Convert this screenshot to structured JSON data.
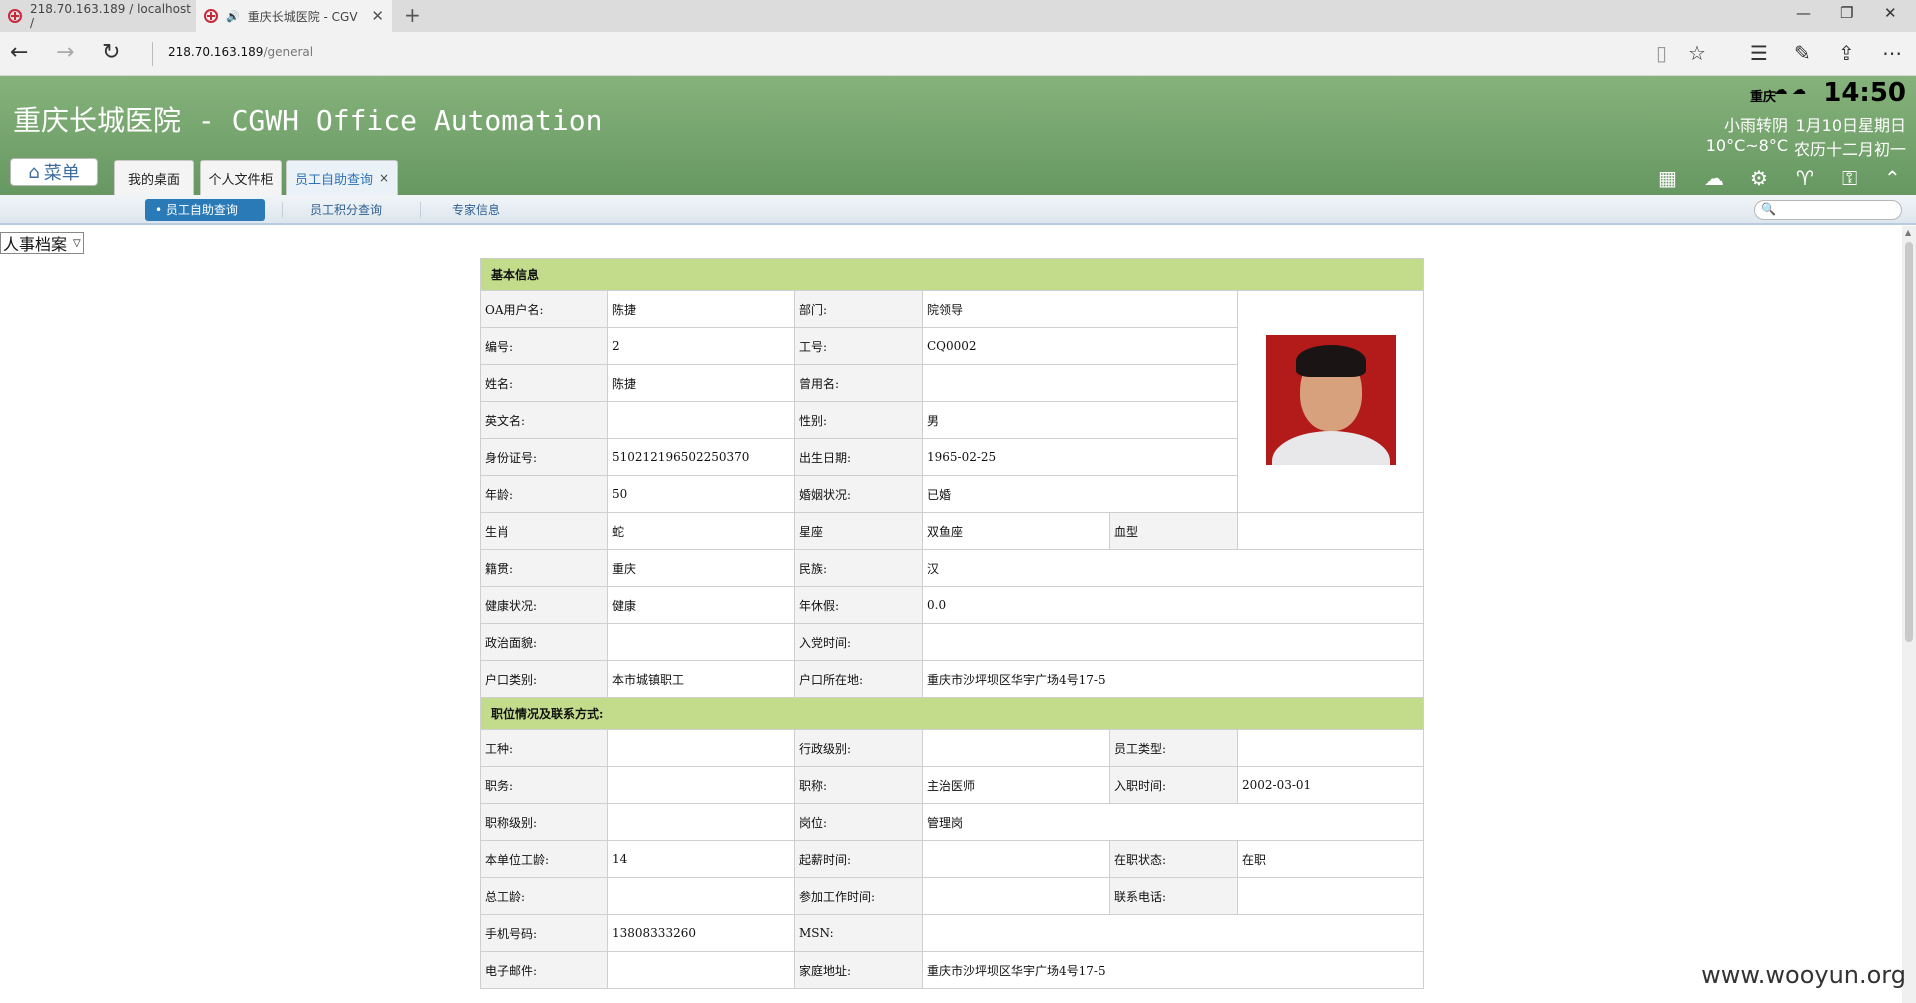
{
  "browser": {
    "tabs": [
      {
        "title": "218.70.163.189 / localhost /"
      },
      {
        "title": "重庆长城医院 - CGV"
      }
    ],
    "address_host": "218.70.163.189",
    "address_path": "/general",
    "icons": [
      "back-icon",
      "forward-icon",
      "refresh-icon",
      "reading-view-icon",
      "favorite-star-icon",
      "hub-icon",
      "web-note-icon",
      "share-icon",
      "more-icon"
    ]
  },
  "app": {
    "title": "重庆长城医院 - CGWH Office Automation",
    "menu_label": "菜单",
    "tabs": [
      {
        "label": "我的桌面"
      },
      {
        "label": "个人文件柜"
      },
      {
        "label": "员工自助查询"
      }
    ],
    "weather": {
      "city": "重庆",
      "time": "14:50",
      "condition": "小雨转阴",
      "date": "1月10日星期日",
      "temperature": "10°C~8°C",
      "lunar": "农历十二月初一"
    },
    "subnav": [
      {
        "label": "员工自助查询"
      },
      {
        "label": "员工积分查询"
      },
      {
        "label": "专家信息"
      }
    ],
    "archive_select": "人事档案",
    "colors": {
      "header_green": "#79a86f",
      "section_green": "#c3dc8c",
      "subnav_active": "#2a7ab8"
    }
  },
  "record": {
    "sections": {
      "basic": "基本信息",
      "position": "职位情况及联系方式:"
    },
    "oa_user": {
      "label": "OA用户名:",
      "value": "陈捷"
    },
    "dept": {
      "label": "部门:",
      "value": "院领导"
    },
    "number": {
      "label": "编号:",
      "value": "2"
    },
    "work_id": {
      "label": "工号:",
      "value": "CQ0002"
    },
    "name": {
      "label": "姓名:",
      "value": "陈捷"
    },
    "former_name": {
      "label": "曾用名:",
      "value": ""
    },
    "english_name": {
      "label": "英文名:",
      "value": ""
    },
    "gender": {
      "label": "性别:",
      "value": "男"
    },
    "id_card": {
      "label": "身份证号:",
      "value": "510212196502250370"
    },
    "birth": {
      "label": "出生日期:",
      "value": "1965-02-25"
    },
    "age": {
      "label": "年龄:",
      "value": "50"
    },
    "marital": {
      "label": "婚姻状况:",
      "value": "已婚"
    },
    "zodiac": {
      "label": "生肖",
      "value": "蛇"
    },
    "constellation": {
      "label": "星座",
      "value": "双鱼座"
    },
    "blood": {
      "label": "血型",
      "value": ""
    },
    "native": {
      "label": "籍贯:",
      "value": "重庆"
    },
    "ethnic": {
      "label": "民族:",
      "value": "汉"
    },
    "health": {
      "label": "健康状况:",
      "value": "健康"
    },
    "annual_leave": {
      "label": "年休假:",
      "value": "0.0"
    },
    "political": {
      "label": "政治面貌:",
      "value": ""
    },
    "party_date": {
      "label": "入党时间:",
      "value": ""
    },
    "hukou_type": {
      "label": "户口类别:",
      "value": "本市城镇职工"
    },
    "hukou_place": {
      "label": "户口所在地:",
      "value": "重庆市沙坪坝区华宇广场4号17-5"
    },
    "job_type": {
      "label": "工种:",
      "value": ""
    },
    "admin_level": {
      "label": "行政级别:",
      "value": ""
    },
    "staff_type": {
      "label": "员工类型:",
      "value": ""
    },
    "duty": {
      "label": "职务:",
      "value": ""
    },
    "title": {
      "label": "职称:",
      "value": "主治医师"
    },
    "hire_date": {
      "label": "入职时间:",
      "value": "2002-03-01"
    },
    "title_level": {
      "label": "职称级别:",
      "value": ""
    },
    "post": {
      "label": "岗位:",
      "value": "管理岗"
    },
    "unit_years": {
      "label": "本单位工龄:",
      "value": "14"
    },
    "pay_start": {
      "label": "起薪时间:",
      "value": ""
    },
    "status": {
      "label": "在职状态:",
      "value": "在职"
    },
    "total_years": {
      "label": "总工龄:",
      "value": ""
    },
    "work_start": {
      "label": "参加工作时间:",
      "value": ""
    },
    "phone": {
      "label": "联系电话:",
      "value": ""
    },
    "mobile": {
      "label": "手机号码:",
      "value": "13808333260"
    },
    "msn": {
      "label": "MSN:",
      "value": ""
    },
    "email": {
      "label": "电子邮件:",
      "value": ""
    },
    "address": {
      "label": "家庭地址:",
      "value": "重庆市沙坪坝区华宇广场4号17-5"
    }
  },
  "watermark": "www.wooyun.org"
}
